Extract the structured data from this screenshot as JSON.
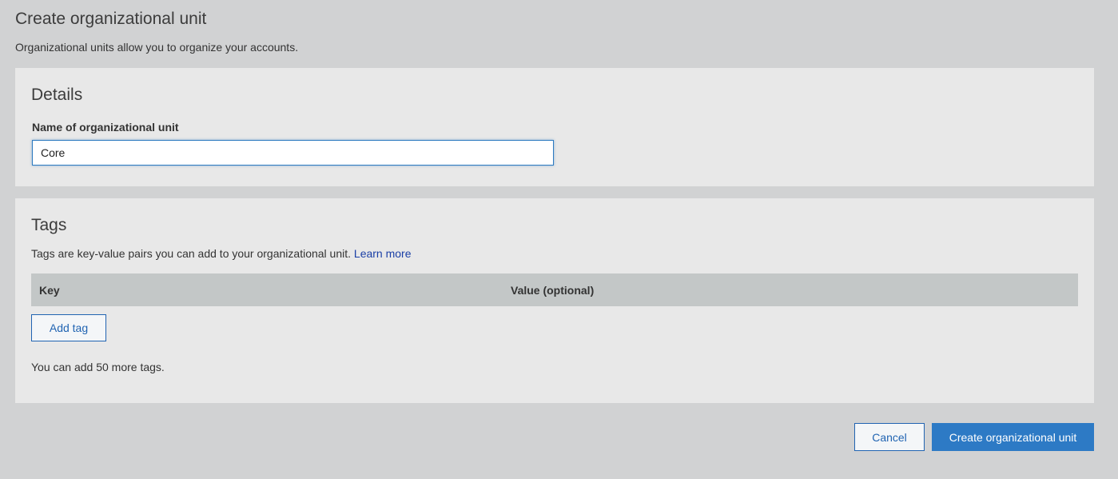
{
  "header": {
    "title": "Create organizational unit",
    "subtitle": "Organizational units allow you to organize your accounts."
  },
  "details": {
    "heading": "Details",
    "name_label": "Name of organizational unit",
    "name_value": "Core"
  },
  "tags": {
    "heading": "Tags",
    "description": "Tags are key-value pairs you can add to your organizational unit.",
    "learn_more": "Learn more",
    "columns": {
      "key": "Key",
      "value": "Value (optional)"
    },
    "add_tag_label": "Add tag",
    "remaining_text": "You can add 50 more tags."
  },
  "footer": {
    "cancel_label": "Cancel",
    "create_label": "Create organizational unit"
  },
  "colors": {
    "background": "#d1d2d3",
    "panel": "#e8e8e8",
    "primary": "#2d7ac5",
    "link": "#1a3fa6",
    "table_header": "#c3c7c7"
  }
}
